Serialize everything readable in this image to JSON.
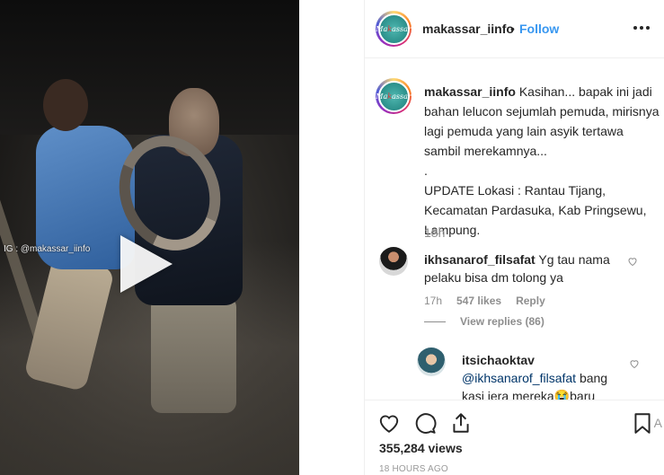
{
  "video": {
    "watermark": "IG : @makassar_iinfo"
  },
  "header": {
    "avatar_text": "Makassar info",
    "username": "makassar_iinfo",
    "separator": "•",
    "follow_label": "Follow"
  },
  "caption": {
    "username": "makassar_iinfo",
    "text": "Kasihan... bapak ini jadi bahan lelucon sejumlah pemuda, mirisnya lagi pemuda yang lain asyik tertawa sambil merekamnya...\n.\nUPDATE Lokasi : Rantau Tijang, Kecamatan Pardasuka, Kab Pringsewu, Lampung.",
    "time": "18h"
  },
  "comments": [
    {
      "username": "ikhsanarof_filsafat",
      "text": "Yg tau nama pelaku bisa dm tolong ya",
      "time": "17h",
      "likes": "547 likes",
      "reply_label": "Reply",
      "view_replies": "View replies (86)"
    },
    {
      "username": "itsichaoktav",
      "mention": "@ikhsanarof_filsafat",
      "text": "bang kasi jera mereka😭baru"
    }
  ],
  "footer": {
    "views": "355,284 views",
    "posted": "18 HOURS AGO",
    "truncated": "A"
  },
  "icons": {
    "more": "more-options-icon",
    "like": "heart-icon",
    "comment": "comment-icon",
    "share": "share-icon",
    "save": "bookmark-icon",
    "play": "play-icon"
  }
}
